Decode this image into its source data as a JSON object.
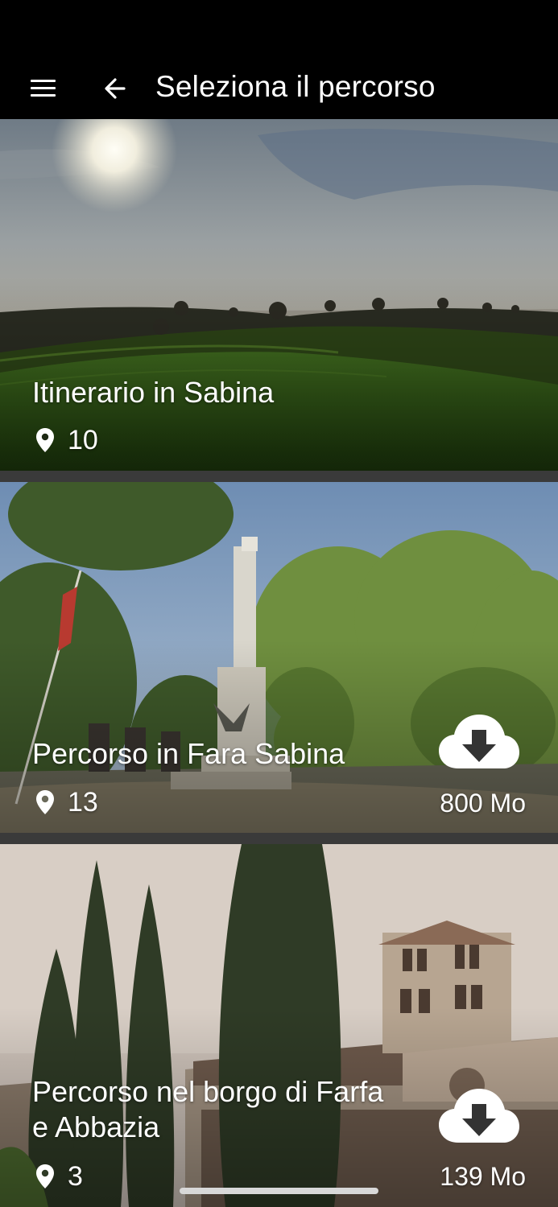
{
  "appbar": {
    "title": "Seleziona il percorso",
    "menu_icon": "hamburger-menu-icon",
    "back_icon": "arrow-back-icon"
  },
  "routes": [
    {
      "title_lines": [
        "Itinerario in Sabina"
      ],
      "poi_count": "10",
      "size": "",
      "downloadable": false
    },
    {
      "title_lines": [
        "Percorso in Fara Sabina"
      ],
      "poi_count": "13",
      "size": "800 Mo",
      "downloadable": true
    },
    {
      "title_lines": [
        "Percorso nel borgo di Farfa",
        "e Abbazia"
      ],
      "poi_count": "3",
      "size": "139 Mo",
      "downloadable": true
    }
  ],
  "icons": {
    "poi": "map-pin-icon",
    "download": "cloud-download-icon"
  },
  "colors": {
    "appbar": "#000000",
    "separator": "#3a3a3a",
    "text": "#ffffff"
  }
}
